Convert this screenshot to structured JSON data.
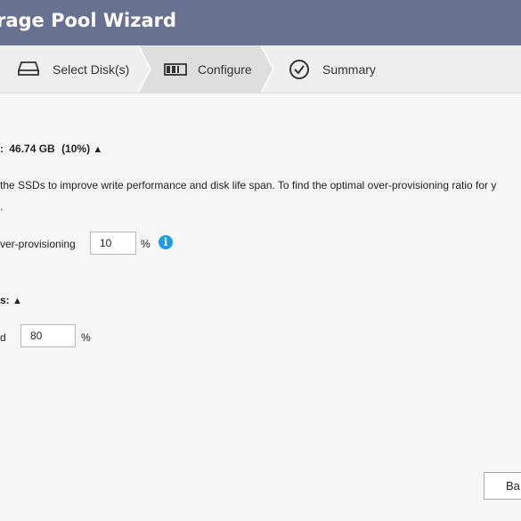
{
  "header": {
    "title": "rage Pool Wizard"
  },
  "steps": [
    {
      "label": "Select Disk(s)",
      "icon": "hard-disk-icon"
    },
    {
      "label": "Configure",
      "icon": "disk-array-icon"
    },
    {
      "label": "Summary",
      "icon": "check-circle-icon"
    }
  ],
  "overprovision": {
    "heading_prefix": ":",
    "heading_value": "46.74 GB",
    "heading_pct": "(10%)",
    "toggle_glyph": "▲",
    "description": "the SSDs to improve write performance and disk life span. To find the optimal over-provisioning ratio for y",
    "description_tail": ".",
    "field_label": "ver-provisioning",
    "field_value": "10",
    "unit": "%"
  },
  "alert": {
    "heading": "s:",
    "toggle_glyph": "▲",
    "field_label": "d",
    "field_value": "80",
    "unit": "%"
  },
  "footer": {
    "back_label": "Ba"
  },
  "colors": {
    "header": "#697191",
    "info": "#1f9be6"
  }
}
